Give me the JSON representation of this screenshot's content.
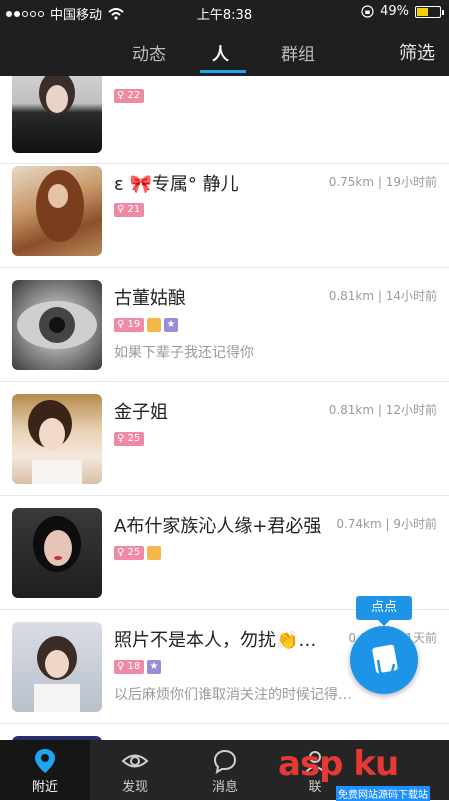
{
  "status_bar": {
    "carrier": "中国移动",
    "time": "上午8:38",
    "battery": "49%"
  },
  "nav": {
    "tabs": [
      {
        "label": "动态"
      },
      {
        "label": "人"
      },
      {
        "label": "群组"
      }
    ],
    "active_tab": "人",
    "filter_label": "筛选",
    "accent": "#1ea5f2"
  },
  "people": [
    {
      "name": "",
      "badge_age": "22",
      "meta": "",
      "signature": ""
    },
    {
      "name": "ε 🎀专属° 静儿",
      "badge_age": "21",
      "meta": "0.75km | 19小时前",
      "signature": ""
    },
    {
      "name": "古董姑酿",
      "badge_age": "19",
      "meta": "0.81km | 14小时前",
      "signature": "如果下辈子我还记得你"
    },
    {
      "name": "金子姐",
      "badge_age": "25",
      "meta": "0.81km | 12小时前",
      "signature": ""
    },
    {
      "name": "A布什家族沁人缘+君必强",
      "badge_age": "25",
      "meta": "0.74km | 9小时前",
      "signature": ""
    },
    {
      "name": "照片不是本人，勿扰👏…",
      "badge_age": "18",
      "meta": "0.86km | 1天前",
      "signature": "以后麻烦你们谁取消关注的时候记得…"
    }
  ],
  "float_button": {
    "label": "点点"
  },
  "tabbar": {
    "items": [
      {
        "label": "附近",
        "icon": "location-pin-icon"
      },
      {
        "label": "发现",
        "icon": "eye-icon"
      },
      {
        "label": "消息",
        "icon": "chat-bubble-icon"
      },
      {
        "label": "联",
        "icon": "contacts-icon"
      }
    ]
  },
  "watermark": {
    "text": "asp ku",
    "sub": "免费网站源码下载站"
  }
}
